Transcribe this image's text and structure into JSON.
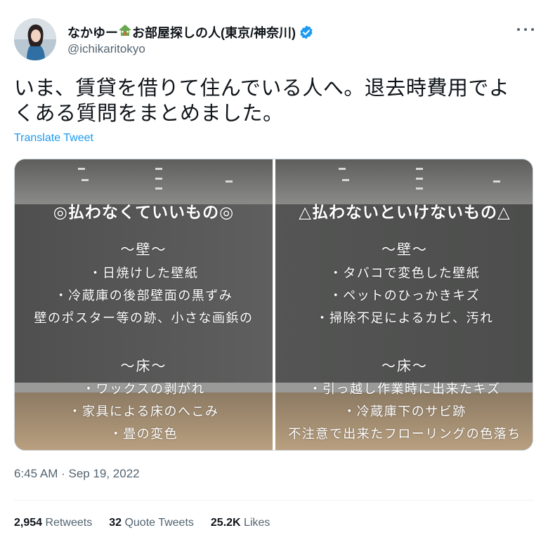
{
  "user": {
    "display_name": "なかゆー🏡お部屋探しの人(東京/神奈川)",
    "display_name_parts": [
      "なかゆー",
      "お部屋探しの人(東京/神奈川)"
    ],
    "handle": "@ichikaritokyo",
    "verified": true
  },
  "tweet": {
    "text_line1": "いま、賃貸を借りて住んでいる人へ。退去時費用でよ",
    "text_line2": "くある質問をまとめました。",
    "translate_label": "Translate Tweet",
    "timestamp": "6:45 AM · Sep 19, 2022"
  },
  "media": {
    "left": {
      "heading": "◎払わなくていいもの◎",
      "section_wall": "〜壁〜",
      "wall_items": [
        "・日焼けした壁紙",
        "・冷蔵庫の後部壁面の黒ずみ",
        "壁のポスター等の跡、小さな画鋲の"
      ],
      "section_floor": "〜床〜",
      "floor_items": [
        "・ワックスの剥がれ",
        "・家具による床のへこみ",
        "・畳の変色"
      ]
    },
    "right": {
      "heading": "△払わないといけないもの△",
      "section_wall": "〜壁〜",
      "wall_items": [
        "・タバコで変色した壁紙",
        "・ペットのひっかきキズ",
        "・掃除不足によるカビ、汚れ"
      ],
      "section_floor": "〜床〜",
      "floor_items": [
        "・引っ越し作業時に出来たキズ",
        "・冷蔵庫下のサビ跡",
        "不注意で出来たフローリングの色落ち"
      ]
    }
  },
  "stats": {
    "retweets_count": "2,954",
    "retweets_label": "Retweets",
    "quotes_count": "32",
    "quotes_label": "Quote Tweets",
    "likes_count": "25.2K",
    "likes_label": "Likes"
  },
  "colors": {
    "link": "#1d9bf0",
    "verified": "#1d9bf0",
    "muted": "#536471"
  },
  "icons": [
    "house-icon",
    "verified-icon",
    "more-icon"
  ]
}
